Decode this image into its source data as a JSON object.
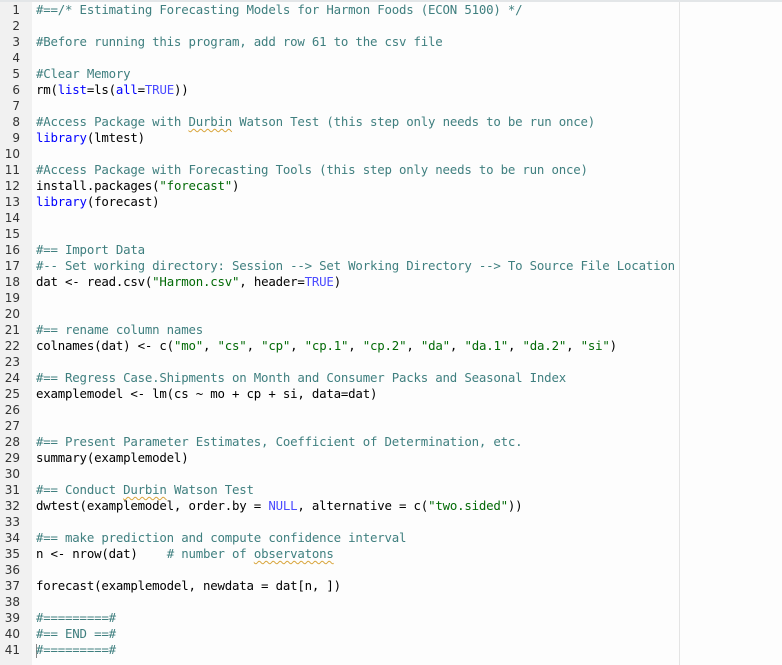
{
  "editor": {
    "language": "R",
    "lines": [
      {
        "n": "1",
        "segments": [
          {
            "t": "#==/* Estimating Forecasting Models for Harmon Foods (ECON 5100) */",
            "c": "comment"
          }
        ]
      },
      {
        "n": "2",
        "segments": []
      },
      {
        "n": "3",
        "segments": [
          {
            "t": "#Before running this program, add row 61 to the csv file",
            "c": "comment"
          }
        ]
      },
      {
        "n": "4",
        "segments": []
      },
      {
        "n": "5",
        "segments": [
          {
            "t": "#Clear Memory",
            "c": "comment"
          }
        ]
      },
      {
        "n": "6",
        "segments": [
          {
            "t": "rm(",
            "c": "fn"
          },
          {
            "t": "list",
            "c": "kw"
          },
          {
            "t": "=ls(",
            "c": "fn"
          },
          {
            "t": "all",
            "c": "kw"
          },
          {
            "t": "=",
            "c": "fn"
          },
          {
            "t": "TRUE",
            "c": "const"
          },
          {
            "t": "))",
            "c": "fn"
          }
        ]
      },
      {
        "n": "7",
        "segments": []
      },
      {
        "n": "8",
        "segments": [
          {
            "t": "#Access Package with ",
            "c": "comment"
          },
          {
            "t": "Durbin",
            "c": "comment spell"
          },
          {
            "t": " Watson Test (this step only needs to be run once)",
            "c": "comment"
          }
        ]
      },
      {
        "n": "9",
        "segments": [
          {
            "t": "library",
            "c": "kw"
          },
          {
            "t": "(lmtest)",
            "c": "fn"
          }
        ]
      },
      {
        "n": "10",
        "segments": []
      },
      {
        "n": "11",
        "segments": [
          {
            "t": "#Access Package with Forecasting Tools (this step only needs to be run once)",
            "c": "comment"
          }
        ]
      },
      {
        "n": "12",
        "segments": [
          {
            "t": "install.packages(",
            "c": "fn"
          },
          {
            "t": "\"forecast\"",
            "c": "str"
          },
          {
            "t": ")",
            "c": "fn"
          }
        ]
      },
      {
        "n": "13",
        "segments": [
          {
            "t": "library",
            "c": "kw"
          },
          {
            "t": "(forecast)",
            "c": "fn"
          }
        ]
      },
      {
        "n": "14",
        "segments": []
      },
      {
        "n": "15",
        "segments": []
      },
      {
        "n": "16",
        "segments": [
          {
            "t": "#== Import Data",
            "c": "comment"
          }
        ]
      },
      {
        "n": "17",
        "segments": [
          {
            "t": "#-- Set working directory: Session --> Set Working Directory --> To Source File Location",
            "c": "comment"
          }
        ]
      },
      {
        "n": "18",
        "segments": [
          {
            "t": "dat <- read.csv(",
            "c": "fn"
          },
          {
            "t": "\"Harmon.csv\"",
            "c": "str"
          },
          {
            "t": ", header=",
            "c": "fn"
          },
          {
            "t": "TRUE",
            "c": "const"
          },
          {
            "t": ")",
            "c": "fn"
          }
        ]
      },
      {
        "n": "19",
        "segments": []
      },
      {
        "n": "20",
        "segments": []
      },
      {
        "n": "21",
        "segments": [
          {
            "t": "#== rename column names",
            "c": "comment"
          }
        ]
      },
      {
        "n": "22",
        "segments": [
          {
            "t": "colnames(dat) <- c(",
            "c": "fn"
          },
          {
            "t": "\"mo\"",
            "c": "str"
          },
          {
            "t": ", ",
            "c": "fn"
          },
          {
            "t": "\"cs\"",
            "c": "str"
          },
          {
            "t": ", ",
            "c": "fn"
          },
          {
            "t": "\"cp\"",
            "c": "str"
          },
          {
            "t": ", ",
            "c": "fn"
          },
          {
            "t": "\"cp.1\"",
            "c": "str"
          },
          {
            "t": ", ",
            "c": "fn"
          },
          {
            "t": "\"cp.2\"",
            "c": "str"
          },
          {
            "t": ", ",
            "c": "fn"
          },
          {
            "t": "\"da\"",
            "c": "str"
          },
          {
            "t": ", ",
            "c": "fn"
          },
          {
            "t": "\"da.1\"",
            "c": "str"
          },
          {
            "t": ", ",
            "c": "fn"
          },
          {
            "t": "\"da.2\"",
            "c": "str"
          },
          {
            "t": ", ",
            "c": "fn"
          },
          {
            "t": "\"si\"",
            "c": "str"
          },
          {
            "t": ")",
            "c": "fn"
          }
        ]
      },
      {
        "n": "23",
        "segments": []
      },
      {
        "n": "24",
        "segments": [
          {
            "t": "#== Regress Case.Shipments on Month and Consumer Packs and Seasonal Index",
            "c": "comment"
          }
        ]
      },
      {
        "n": "25",
        "segments": [
          {
            "t": "examplemodel <- lm(cs ~ mo + cp + si, data=dat)",
            "c": "fn"
          }
        ]
      },
      {
        "n": "26",
        "segments": []
      },
      {
        "n": "27",
        "segments": []
      },
      {
        "n": "28",
        "segments": [
          {
            "t": "#== Present Parameter Estimates, Coefficient of Determination, etc.",
            "c": "comment"
          }
        ]
      },
      {
        "n": "29",
        "segments": [
          {
            "t": "summary(examplemodel)",
            "c": "fn"
          }
        ]
      },
      {
        "n": "30",
        "segments": []
      },
      {
        "n": "31",
        "segments": [
          {
            "t": "#== Conduct ",
            "c": "comment"
          },
          {
            "t": "Durbin",
            "c": "comment spell"
          },
          {
            "t": " Watson Test",
            "c": "comment"
          }
        ]
      },
      {
        "n": "32",
        "segments": [
          {
            "t": "dwtest(examplemodel, order.by = ",
            "c": "fn"
          },
          {
            "t": "NULL",
            "c": "const"
          },
          {
            "t": ", alternative = c(",
            "c": "fn"
          },
          {
            "t": "\"two.sided\"",
            "c": "str"
          },
          {
            "t": "))",
            "c": "fn"
          }
        ]
      },
      {
        "n": "33",
        "segments": []
      },
      {
        "n": "34",
        "segments": [
          {
            "t": "#== make prediction and compute confidence interval",
            "c": "comment"
          }
        ]
      },
      {
        "n": "35",
        "segments": [
          {
            "t": "n <- nrow(dat)    ",
            "c": "fn"
          },
          {
            "t": "# number of ",
            "c": "comment"
          },
          {
            "t": "observatons",
            "c": "comment spell"
          }
        ]
      },
      {
        "n": "36",
        "segments": []
      },
      {
        "n": "37",
        "segments": [
          {
            "t": "forecast(examplemodel, newdata = dat[n, ])",
            "c": "fn"
          }
        ]
      },
      {
        "n": "38",
        "segments": []
      },
      {
        "n": "39",
        "segments": [
          {
            "t": "#=========#",
            "c": "comment"
          }
        ]
      },
      {
        "n": "40",
        "segments": [
          {
            "t": "#== END ==#",
            "c": "comment"
          }
        ]
      },
      {
        "n": "41",
        "segments": [
          {
            "t": "#=========#",
            "c": "comment",
            "cursor": true
          }
        ]
      }
    ]
  }
}
